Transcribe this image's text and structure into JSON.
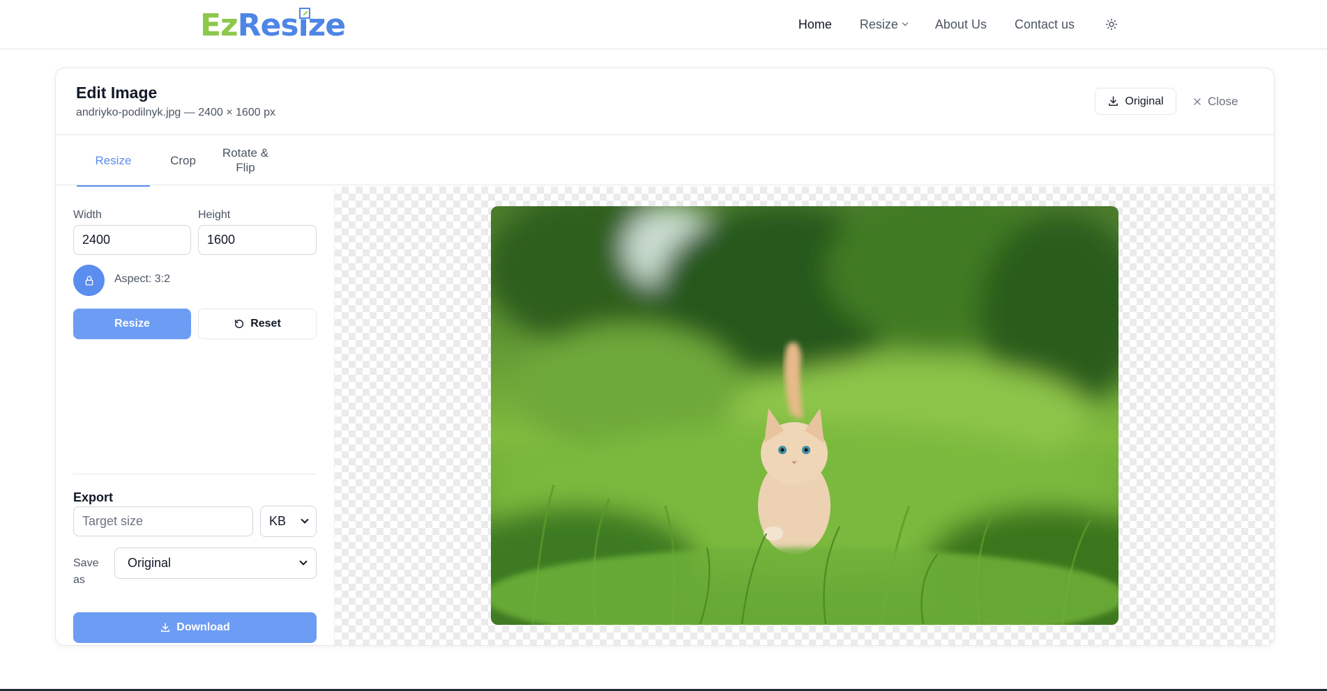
{
  "brand": {
    "part1": "Ez",
    "part2": "Resize"
  },
  "nav": {
    "items": [
      {
        "label": "Home"
      },
      {
        "label": "Resize"
      },
      {
        "label": "About Us"
      },
      {
        "label": "Contact us"
      }
    ]
  },
  "editor": {
    "title": "Edit Image",
    "subtitle": "andriyko-podilnyk.jpg — 2400 × 1600 px",
    "original_label": "Original",
    "close_label": "Close",
    "tabs": [
      {
        "label": "Resize"
      },
      {
        "label": "Crop"
      },
      {
        "label": "Rotate & Flip"
      }
    ],
    "resize": {
      "width_label": "Width",
      "height_label": "Height",
      "width_value": "2400",
      "height_value": "1600",
      "aspect_label": "Aspect: 3:2",
      "resize_button": "Resize",
      "reset_button": "Reset"
    },
    "export": {
      "title": "Export",
      "target_placeholder": "Target size",
      "unit_value": "KB",
      "save_as_label": "Save as",
      "format_value": "Original",
      "download_button": "Download"
    }
  },
  "colors": {
    "accent": "#5b8def",
    "button_blue": "#6c9cf3",
    "logo_green": "#8cc84b",
    "logo_blue": "#4f86e6"
  },
  "icons": [
    "sun-icon",
    "download-icon",
    "close-icon",
    "lock-icon",
    "reset-icon",
    "chevron-down-icon"
  ]
}
